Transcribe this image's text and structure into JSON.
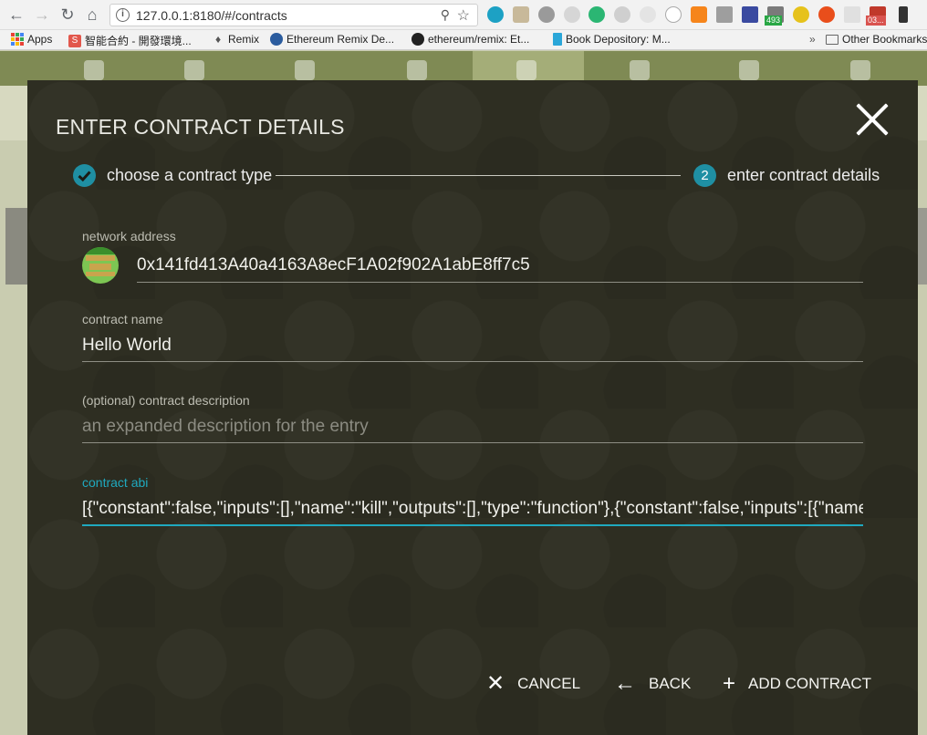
{
  "browser": {
    "url": "127.0.0.1:8180/#/contracts",
    "bookmarks": [
      {
        "label": "Apps"
      },
      {
        "label": "智能合約 - 開發環境..."
      },
      {
        "label": "Remix"
      },
      {
        "label": "Ethereum Remix De..."
      },
      {
        "label": "ethereum/remix: Et..."
      },
      {
        "label": "Book Depository: M..."
      }
    ],
    "overflow": "»",
    "other_bookmarks": "Other Bookmarks",
    "ext_badges": [
      "493",
      "03..."
    ]
  },
  "modal": {
    "title": "ENTER CONTRACT DETAILS",
    "steps": [
      {
        "label": "choose a contract type",
        "state": "done"
      },
      {
        "label": "enter contract details",
        "number": "2",
        "state": "active"
      }
    ],
    "fields": {
      "network_address": {
        "label": "network address",
        "value": "0x141fd413A40a4163A8ecF1A02f902A1abE8ff7c5"
      },
      "contract_name": {
        "label": "contract name",
        "value": "Hello World"
      },
      "contract_description": {
        "label": "(optional) contract description",
        "placeholder": "an expanded description for the entry"
      },
      "contract_abi": {
        "label": "contract abi",
        "value": "[{\"constant\":false,\"inputs\":[],\"name\":\"kill\",\"outputs\":[],\"type\":\"function\"},{\"constant\":false,\"inputs\":[{\"name\""
      }
    },
    "actions": {
      "cancel": "CANCEL",
      "back": "BACK",
      "add": "ADD CONTRACT"
    },
    "accent_color": "#1fa9bf"
  }
}
